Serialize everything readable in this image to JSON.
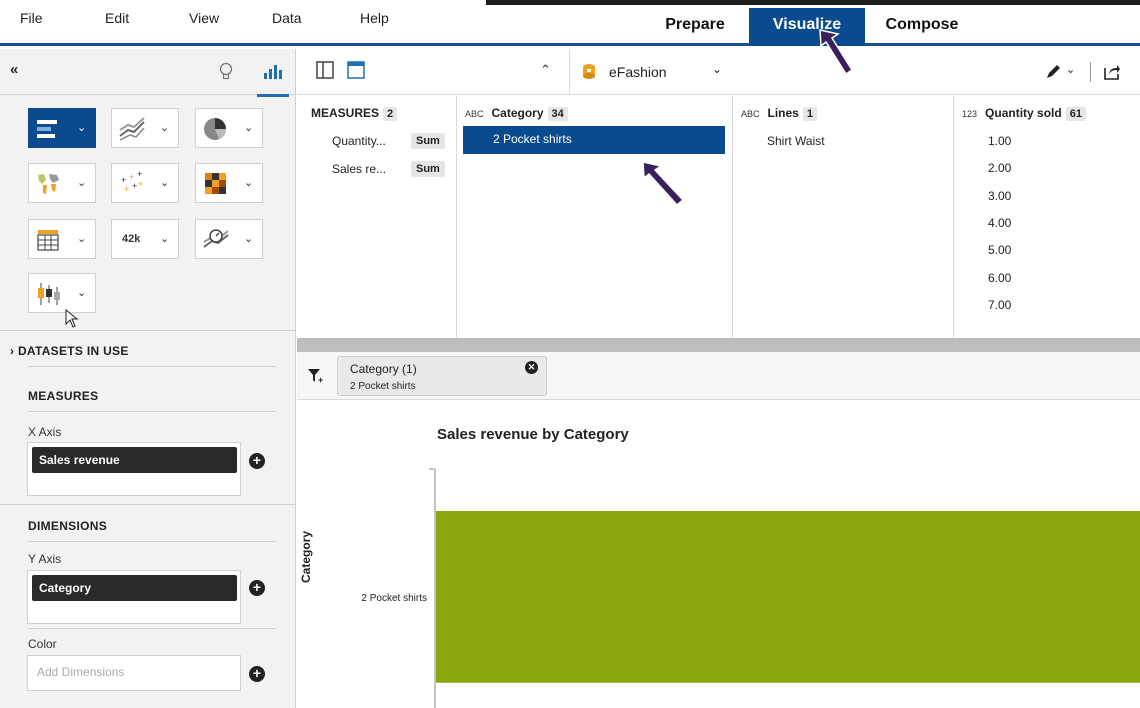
{
  "menu": {
    "items": [
      "File",
      "Edit",
      "View",
      "Data",
      "Help"
    ],
    "modes": [
      "Prepare",
      "Visualize",
      "Compose"
    ],
    "active_mode": "Visualize"
  },
  "left_panel": {
    "collapse_glyph": "«",
    "chart_types": [
      {
        "icon": "bar-chart-icon",
        "selected": true
      },
      {
        "icon": "line-chart-icon",
        "selected": false
      },
      {
        "icon": "pie-chart-icon",
        "selected": false
      },
      {
        "icon": "geo-map-icon",
        "selected": false
      },
      {
        "icon": "scatter-plot-icon",
        "selected": false
      },
      {
        "icon": "heat-map-icon",
        "selected": false
      },
      {
        "icon": "table-icon",
        "selected": false
      },
      {
        "icon": "numeric-point-icon",
        "selected": false
      },
      {
        "icon": "gauge-chart-icon",
        "selected": false
      },
      {
        "icon": "box-plot-icon",
        "selected": false
      }
    ],
    "numeric_point_label": "42k",
    "datasets_in_use": "DATASETS IN USE",
    "measures_title": "MEASURES",
    "x_axis_label": "X Axis",
    "x_axis_value": "Sales revenue",
    "dimensions_title": "DIMENSIONS",
    "y_axis_label": "Y Axis",
    "y_axis_value": "Category",
    "color_label": "Color",
    "color_placeholder": "Add Dimensions"
  },
  "toolbar": {
    "dataset_name": "eFashion"
  },
  "grid": {
    "measures": {
      "title": "MEASURES",
      "count": "2",
      "items": [
        {
          "name": "Quantity...",
          "agg": "Sum"
        },
        {
          "name": "Sales re...",
          "agg": "Sum"
        }
      ]
    },
    "category": {
      "type": "ABC",
      "title": "Category",
      "count": "34",
      "values": [
        "2 Pocket shirts"
      ]
    },
    "lines": {
      "type": "ABC",
      "title": "Lines",
      "count": "1",
      "values": [
        "Shirt Waist"
      ]
    },
    "quantity": {
      "type": "123",
      "title": "Quantity sold",
      "count": "61",
      "values": [
        "1.00",
        "2.00",
        "3.00",
        "4.00",
        "5.00",
        "6.00",
        "7.00"
      ]
    }
  },
  "filter": {
    "title": "Category (1)",
    "value": "2 Pocket shirts"
  },
  "chart_data": {
    "type": "bar",
    "title": "Sales revenue by Category",
    "ylabel": "Category",
    "xlabel": "",
    "categories": [
      "2 Pocket shirts"
    ],
    "values": [
      1
    ],
    "bar_color": "#8aa60d"
  },
  "colors": {
    "accent": "#0a4b8f",
    "bar": "#8aa60d",
    "pointer": "#3b1f5c"
  }
}
